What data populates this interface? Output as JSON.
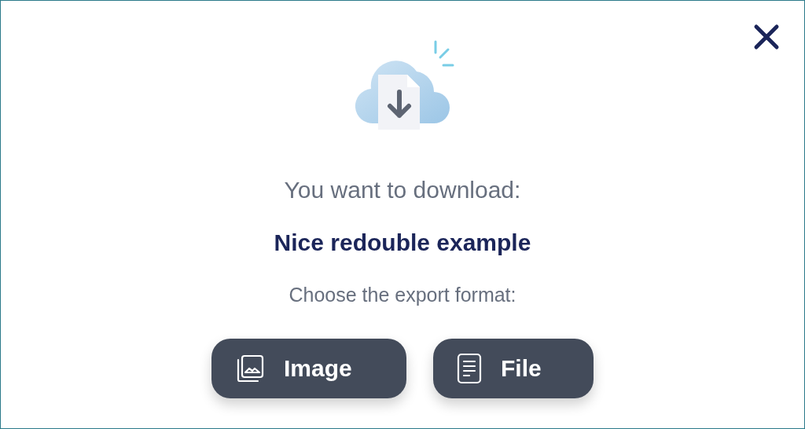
{
  "dialog": {
    "heading": "You want to download:",
    "item_name": "Nice redouble example",
    "prompt": "Choose the export format:",
    "buttons": [
      {
        "kind": "image",
        "label": "Image"
      },
      {
        "kind": "file",
        "label": "File"
      }
    ]
  }
}
